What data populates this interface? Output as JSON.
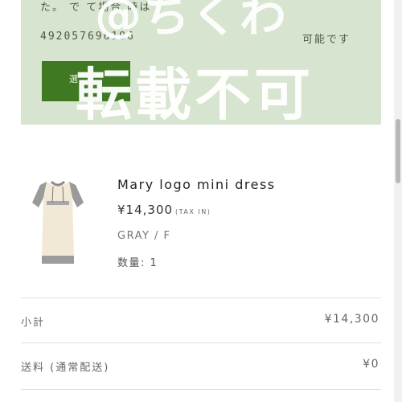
{
  "notice": {
    "line1": "た。 で て場合 時は",
    "number": "492057696196",
    "possible": "可能です",
    "button_label": "選"
  },
  "watermark": {
    "handle": "@ちくわ",
    "text": "転載不可"
  },
  "product": {
    "name": "Mary logo mini dress",
    "price": "¥14,300",
    "tax": "(TAX IN)",
    "variant": "GRAY / F",
    "quantity": "数量: 1",
    "image_icon": "dress-thumbnail"
  },
  "summary": {
    "subtotal_label": "小計",
    "subtotal_value": "¥14,300",
    "shipping_label": "送料 (通常配送)",
    "shipping_value": "¥0"
  },
  "colors": {
    "notice_bg": "#d7e4cf",
    "button_green": "#3f7a22"
  }
}
